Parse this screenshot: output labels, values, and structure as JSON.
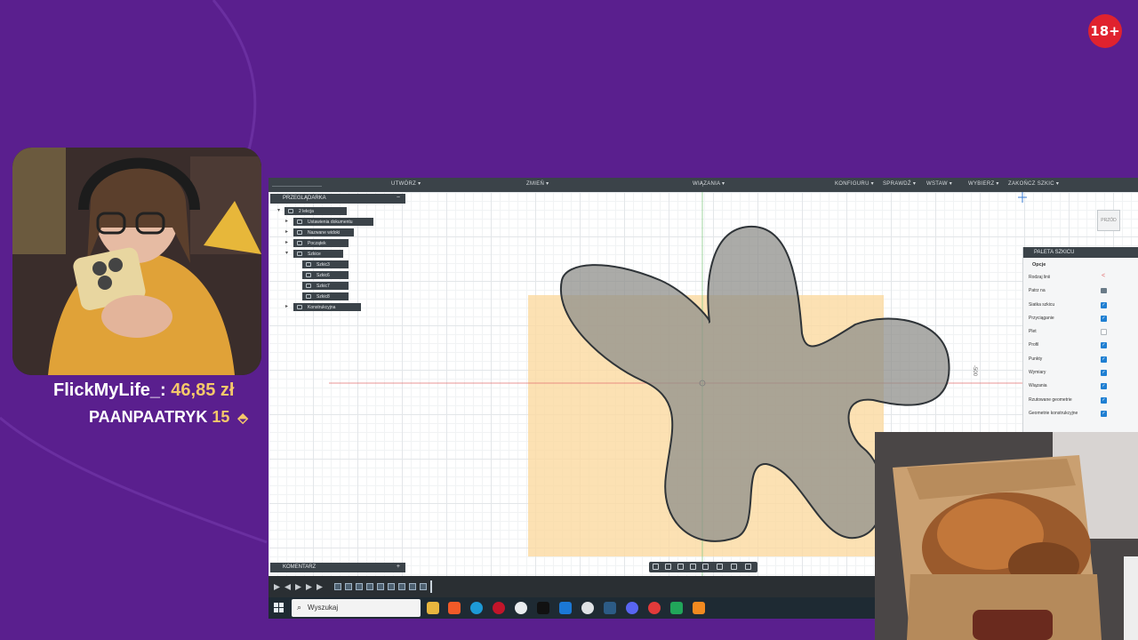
{
  "overlay": {
    "age_badge": "18+",
    "donations": [
      {
        "name": "FlickMyLife_:",
        "amount": "46,85 zł"
      },
      {
        "name": "PAANPAATRYK",
        "amount": "15"
      }
    ]
  },
  "fusion": {
    "menu": [
      "UTWÓRZ ▾",
      "ZMIEŃ ▾",
      "WIĄZANIA ▾",
      "KONFIGURU ▾",
      "SPRAWDŹ ▾",
      "WSTAW ▾",
      "WYBIERZ ▾",
      "ZAKOŃCZ SZKIC ▾"
    ],
    "browser": {
      "title": "PRZEGLĄDARKA",
      "collapse": "−",
      "items": [
        "2 lekcja",
        "Ustawienia dokumentu",
        "Nazwane widoki",
        "Początek",
        "Szkice",
        "Szkic3",
        "Szkic6",
        "Szkic7",
        "Szkic8",
        "Konstrukcyjna"
      ]
    },
    "palette": {
      "title": "PALETA SZKICU",
      "section": "Opcje",
      "rows": [
        {
          "label": "Rodzaj linii",
          "checked": false
        },
        {
          "label": "Patrz na",
          "checked": false
        },
        {
          "label": "Siatka szkicu",
          "checked": true
        },
        {
          "label": "Przyciąganie",
          "checked": true
        },
        {
          "label": "Plet",
          "checked": false
        },
        {
          "label": "Profil",
          "checked": true
        },
        {
          "label": "Punkty",
          "checked": true
        },
        {
          "label": "Wymiary",
          "checked": true
        },
        {
          "label": "Wiązania",
          "checked": true
        },
        {
          "label": "Rzutowane geometrie",
          "checked": true
        },
        {
          "label": "Geometrie konstrukcyjne",
          "checked": true
        }
      ]
    },
    "comment": {
      "title": "KOMENTARZ",
      "plus": "+"
    },
    "viewcube": "PRZÓD",
    "dimension_label": "-500"
  },
  "taskbar": {
    "search_placeholder": "Wyszukaj",
    "icons": [
      "file-explorer-icon",
      "brave-icon",
      "edge-icon",
      "opera-icon",
      "obs-icon",
      "terminal-icon",
      "store-icon",
      "chrome-icon",
      "steam-icon",
      "discord-icon",
      "headset-icon",
      "sheets-icon",
      "fusion-icon"
    ]
  },
  "colors": {
    "background": "#5a1f8e",
    "shape_fill": "#9a9a96",
    "sketch_rect": "#fbd9a0",
    "accent_gold": "#f5c86a",
    "badge_red": "#e0222e"
  }
}
